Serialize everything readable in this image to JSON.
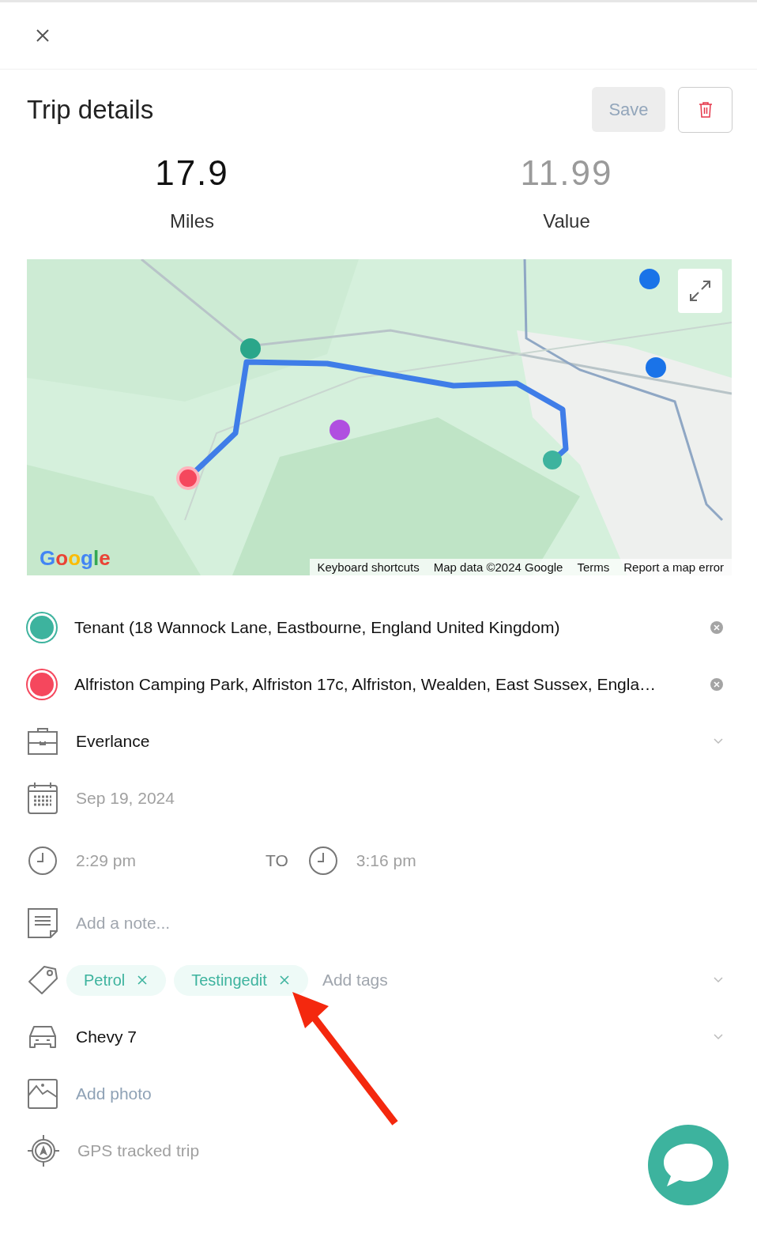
{
  "title": "Trip details",
  "save_button": {
    "label": "Save",
    "disabled": true
  },
  "stats": [
    {
      "value": "17.9",
      "label": "Miles",
      "muted": false
    },
    {
      "value": "11.99",
      "label": "Value",
      "muted": true
    }
  ],
  "map": {
    "logo": "Google",
    "attribution": [
      "Keyboard shortcuts",
      "Map data ©2024 Google",
      "Terms",
      "Report a map error"
    ]
  },
  "stops": [
    {
      "text": "Tenant  (18 Wannock Lane, Eastbourne, England United Kingdom)",
      "color": "#3db39e"
    },
    {
      "text": "Alfriston Camping Park, Alfriston 17c, Alfriston, Wealden, East Sussex, Engla…",
      "color": "#f5475d"
    }
  ],
  "purpose": {
    "value": "Everlance"
  },
  "date": {
    "value": "Sep 19, 2024"
  },
  "time": {
    "start": "2:29 pm",
    "separator": "TO",
    "end": "3:16 pm"
  },
  "note": {
    "placeholder": "Add a note..."
  },
  "tags": {
    "items": [
      "Petrol",
      "Testingedit"
    ],
    "placeholder": "Add tags"
  },
  "vehicle": {
    "value": "Chevy 7"
  },
  "photo": {
    "label": "Add photo"
  },
  "gps": {
    "label": "GPS tracked trip"
  }
}
